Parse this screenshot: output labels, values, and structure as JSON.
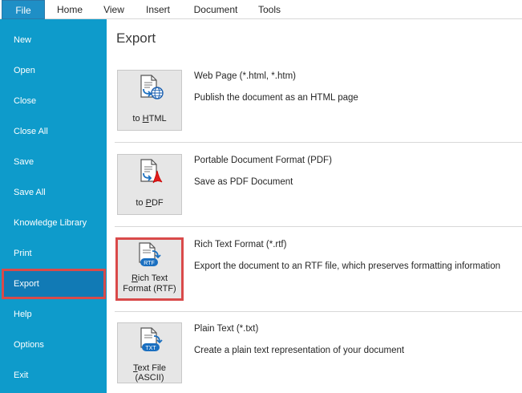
{
  "ribbon": {
    "tabs": [
      {
        "label": "File",
        "selected": true
      },
      {
        "label": "Home"
      },
      {
        "label": "View"
      },
      {
        "label": "Insert"
      },
      {
        "label": "Document"
      },
      {
        "label": "Tools"
      }
    ]
  },
  "nav": {
    "items": [
      {
        "label": "New"
      },
      {
        "label": "Open"
      },
      {
        "label": "Close"
      },
      {
        "label": "Close All"
      },
      {
        "label": "Save"
      },
      {
        "label": "Save All"
      },
      {
        "label": "Knowledge Library"
      },
      {
        "label": "Print"
      },
      {
        "label": "Export",
        "selected": true
      },
      {
        "label": "Help"
      },
      {
        "label": "Options"
      },
      {
        "label": "Exit"
      }
    ]
  },
  "main": {
    "heading": "Export",
    "options": [
      {
        "btn_pre": "to ",
        "btn_u": "H",
        "btn_post": "TML",
        "title": "Web Page (*.html, *.htm)",
        "desc": "Publish the document as an HTML page",
        "icon": "document-globe-icon"
      },
      {
        "btn_pre": "to ",
        "btn_u": "P",
        "btn_post": "DF",
        "title": "Portable Document Format (PDF)",
        "desc": "Save as PDF Document",
        "icon": "document-pdf-icon"
      },
      {
        "btn_u": "R",
        "btn_post": "ich Text",
        "btn_line2": "Format (RTF)",
        "icon_badge": "RTF",
        "title": "Rich Text Format (*.rtf)",
        "desc": "Export the document to an RTF file, which preserves formatting information",
        "icon": "document-rtf-icon",
        "highlighted": true
      },
      {
        "btn_u": "T",
        "btn_post": "ext File (ASCII)",
        "icon_badge": "TXT",
        "title": "Plain Text (*.txt)",
        "desc": "Create a plain text representation of your document",
        "icon": "document-txt-icon"
      }
    ]
  },
  "colors": {
    "nav_bg": "#0e9bcb",
    "nav_selected": "#117ab5",
    "highlight_border": "#d94a4a",
    "file_tab": "#1f8fc6"
  }
}
